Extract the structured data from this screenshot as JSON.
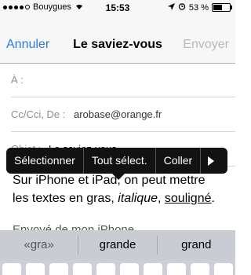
{
  "status_bar": {
    "carrier": "Bouygues",
    "time": "15:53",
    "battery_text": "53 %",
    "battery_level": 0.53
  },
  "nav": {
    "cancel_label": "Annuler",
    "title": "Le saviez-vous",
    "send_label": "Envoyer"
  },
  "fields": {
    "to_label": "À :",
    "cc_label": "Cc/Cci, De :",
    "cc_value": "arobase@orange.fr",
    "subject_label": "Objet :",
    "subject_value": "Le saviez-vous"
  },
  "body": {
    "line1": "Sur iPhone et iPad, on peut mettre",
    "line2_prefix": "les textes en gras, ",
    "italic_word": "italique",
    "comma": ", ",
    "underlined_word": "souligné",
    "period": ".",
    "signature": "Envoyé de mon iPhone"
  },
  "popup": {
    "select_label": "Sélectionner",
    "select_all_label": "Tout sélect.",
    "paste_label": "Coller"
  },
  "keyboard": {
    "suggestions": [
      "«gra»",
      "grande",
      "grand"
    ]
  }
}
